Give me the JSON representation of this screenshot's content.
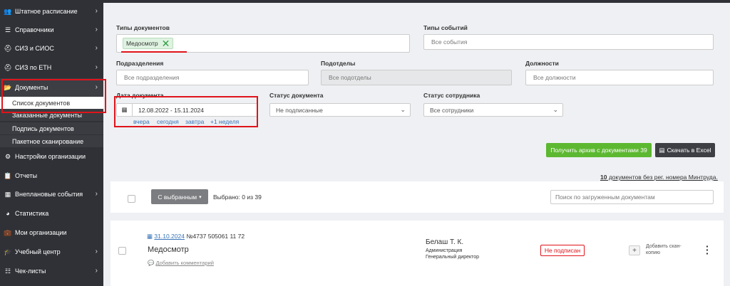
{
  "sidebar": {
    "items": [
      {
        "label": "Штатное расписание",
        "icon": "users-icon"
      },
      {
        "label": "Справочники",
        "icon": "list-icon"
      },
      {
        "label": "СИЗ и СИОС",
        "icon": "helmet-icon"
      },
      {
        "label": "СИЗ по ЕТН",
        "icon": "helmet-icon"
      },
      {
        "label": "Документы",
        "icon": "folder-icon"
      },
      {
        "label": "Настройки организации",
        "icon": "gear-icon"
      },
      {
        "label": "Отчеты",
        "icon": "clipboard-icon"
      },
      {
        "label": "Внеплановые события",
        "icon": "calendar-icon"
      },
      {
        "label": "Статистика",
        "icon": "pie-chart-icon"
      },
      {
        "label": "Мои организации",
        "icon": "briefcase-icon"
      },
      {
        "label": "Учебный центр",
        "icon": "graduation-cap-icon"
      },
      {
        "label": "Чек-листы",
        "icon": "checklist-icon"
      }
    ],
    "subitems": [
      "Список документов",
      "Заказанные документы",
      "Подпись документов",
      "Пакетное сканирование"
    ]
  },
  "filters": {
    "doc_types_label": "Типы документов",
    "doc_type_tag": "Медосмотр",
    "event_types_label": "Типы событий",
    "event_types_placeholder": "Все события",
    "divisions_label": "Подразделения",
    "divisions_placeholder": "Все подразделения",
    "subdivisions_label": "Подотделы",
    "subdivisions_placeholder": "Все подотделы",
    "positions_label": "Должности",
    "positions_placeholder": "Все должности",
    "date_label": "Дата документа",
    "date_value": "12.08.2022 - 15.11.2024",
    "quick_dates": [
      "вчера",
      "сегодня",
      "завтра",
      "+1 неделя"
    ],
    "doc_status_label": "Статус документа",
    "doc_status_value": "Не подписанные",
    "employee_status_label": "Статус сотрудника",
    "employee_status_value": "Все сотрудники",
    "archive_button": "Получить архив с документами 39",
    "excel_button": "Скачать в Excel"
  },
  "list": {
    "notice_link": "10",
    "notice_text": " документов без рег. номера Минтруда.",
    "bulk_button": "С выбранным",
    "selected_text": "Выбрано: 0 из 39",
    "search_placeholder": "Поиск по загруженным документам",
    "documents": [
      {
        "date": "31.10.2024",
        "number": "№4737 505061 11 72",
        "title": "Медосмотр",
        "comment_link": "Добавить комментарий",
        "employee_name": "Белаш Т. К.",
        "employee_dept": "Администрация",
        "employee_position": "Генеральный директор",
        "status": "Не подписан",
        "add_scan": "Добавить скан-копию"
      }
    ]
  },
  "colors": {
    "sidebar_bg": "#2f3136",
    "highlight_red": "#e0141b",
    "green_button": "#5cb830",
    "link_blue": "#3a74b8"
  }
}
